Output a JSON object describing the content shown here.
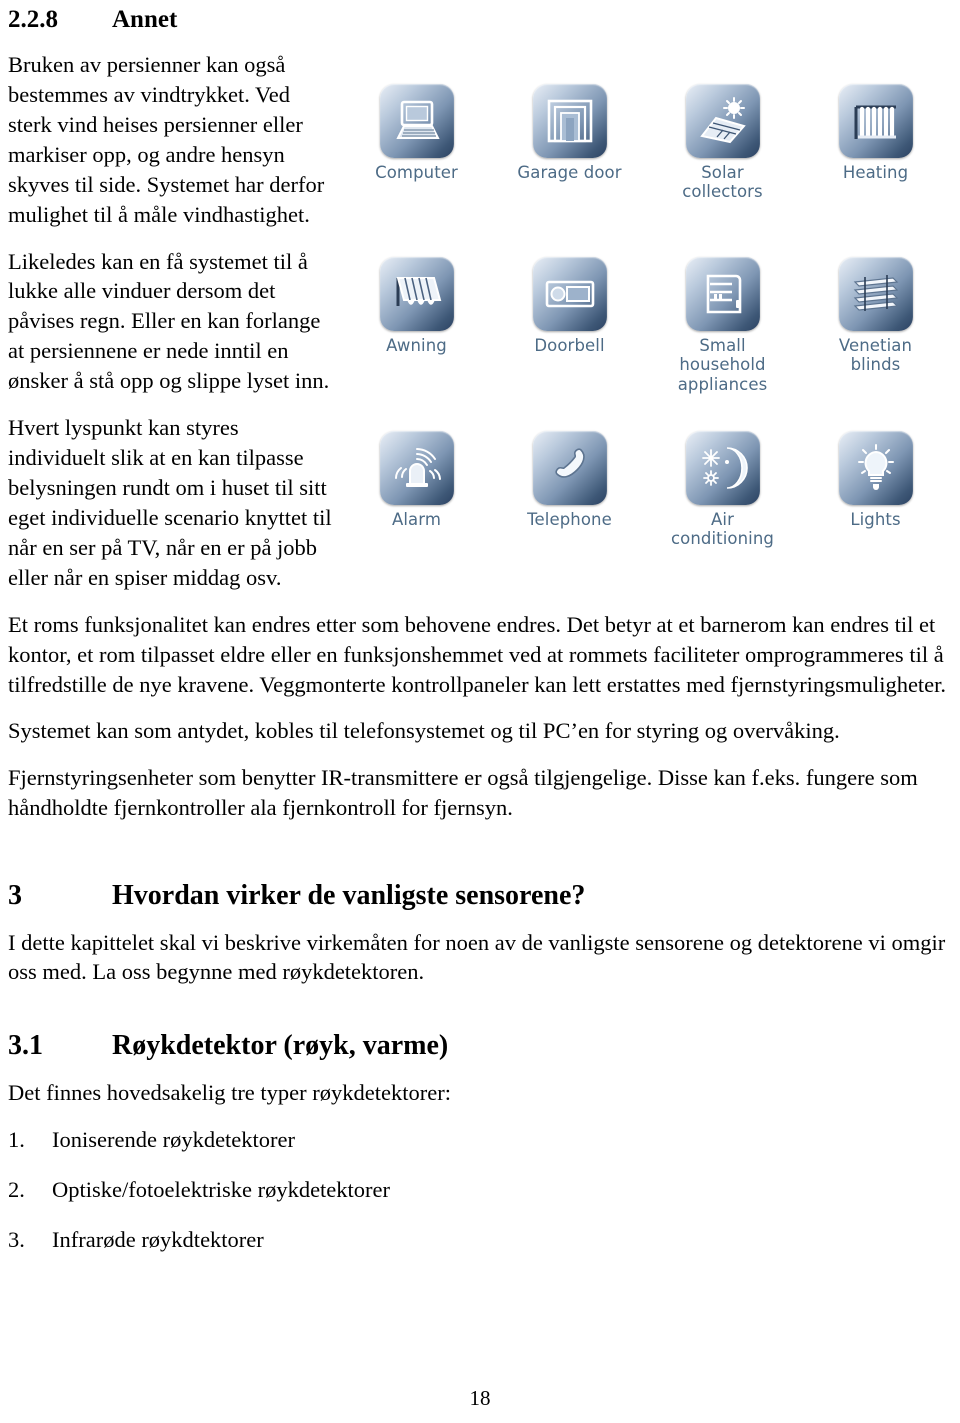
{
  "section_2_2_8": {
    "number": "2.2.8",
    "title": "Annet"
  },
  "paragraphs": {
    "p1": "Bruken av persienner kan også bestemmes av vindtrykket. Ved sterk vind heises persienner eller markiser opp, og andre hensyn skyves til side. Systemet har derfor mulighet til å måle vindhastighet.",
    "p2": "Likeledes kan en få systemet til å lukke alle vinduer dersom det påvises regn. Eller en kan forlange at persiennene er nede inntil en ønsker å stå opp og slippe lyset inn.",
    "p3": "Hvert lyspunkt kan styres individuelt slik at en kan tilpasse belysningen rundt om i huset til sitt eget individuelle scenario knyttet til når en ser på TV, når en er på jobb eller når en spiser middag osv.",
    "p4": "Et roms funksjonalitet kan endres etter som behovene endres. Det betyr at et barnerom kan endres til et kontor, et rom tilpasset eldre eller en funksjonshemmet ved at rommets faciliteter omprogrammeres til å tilfredstille de nye kravene. Veggmonterte kontrollpaneler kan lett erstattes med fjernstyringsmuligheter.",
    "p5": "Systemet kan som antydet, kobles til telefonsystemet og til PC’en for styring og overvåking.",
    "p6": "Fjernstyringsenheter som benytter IR-transmittere er også tilgjengelige. Disse kan f.eks. fungere som håndholdte fjernkontroller ala fjernkontroll for fjernsyn."
  },
  "figure": {
    "icons": [
      {
        "label": "Computer",
        "icon": "computer-icon"
      },
      {
        "label": "Garage door",
        "icon": "garage-door-icon"
      },
      {
        "label": "Solar\ncollectors",
        "icon": "solar-collectors-icon"
      },
      {
        "label": "Heating",
        "icon": "radiator-icon"
      },
      {
        "label": "Awning",
        "icon": "awning-icon"
      },
      {
        "label": "Doorbell",
        "icon": "doorbell-icon"
      },
      {
        "label": "Small\nhousehold\nappliances",
        "icon": "appliances-icon"
      },
      {
        "label": "Venetian\nblinds",
        "icon": "venetian-blinds-icon"
      },
      {
        "label": "Alarm",
        "icon": "alarm-siren-icon"
      },
      {
        "label": "Telephone",
        "icon": "telephone-handset-icon"
      },
      {
        "label": "Air\nconditioning",
        "icon": "air-conditioning-icon"
      },
      {
        "label": "Lights",
        "icon": "lightbulb-icon"
      }
    ],
    "label_color": "#4d6b86"
  },
  "section_3": {
    "number": "3",
    "title": "Hvordan virker de vanligste sensorene?",
    "intro": "I dette kapittelet skal vi beskrive virkemåten for noen av de vanligste sensorene og detektorene vi omgir oss med. La oss begynne med røykdetektoren."
  },
  "section_3_1": {
    "number": "3.1",
    "title": "Røykdetektor (røyk, varme)",
    "lead": "Det finnes hovedsakelig tre typer røykdetektorer:",
    "items": [
      {
        "marker": "1.",
        "text": "Ioniserende røykdetektorer"
      },
      {
        "marker": "2.",
        "text": "Optiske/fotoelektriske røykdetektorer"
      },
      {
        "marker": "3.",
        "text": "Infrarøde røykdtektorer"
      }
    ]
  },
  "footer": {
    "page_number": "18"
  }
}
